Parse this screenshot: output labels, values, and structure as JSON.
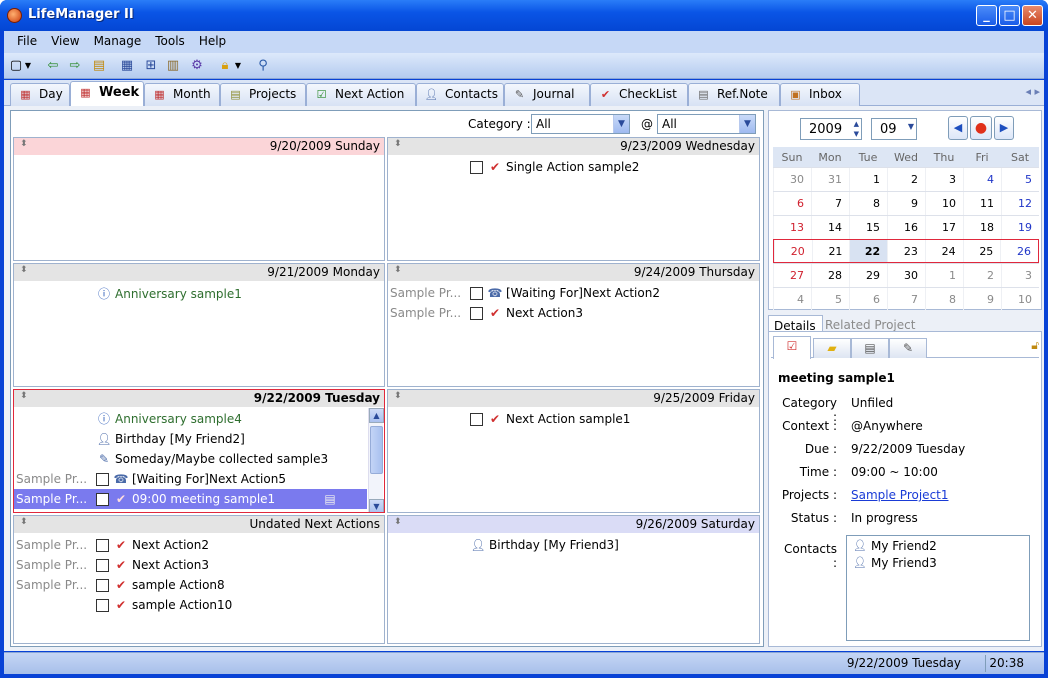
{
  "window": {
    "title": "LifeManager II"
  },
  "menu": [
    "File",
    "View",
    "Manage",
    "Tools",
    "Help"
  ],
  "tabs": [
    {
      "label": "Day",
      "icon": "calendar-day-icon"
    },
    {
      "label": "Week",
      "icon": "calendar-week-icon",
      "active": true
    },
    {
      "label": "Month",
      "icon": "calendar-month-icon"
    },
    {
      "label": "Projects",
      "icon": "projects-icon"
    },
    {
      "label": "Next Action",
      "icon": "next-action-icon"
    },
    {
      "label": "Contacts",
      "icon": "contacts-icon"
    },
    {
      "label": "Journal",
      "icon": "journal-icon"
    },
    {
      "label": "CheckList",
      "icon": "checklist-icon"
    },
    {
      "label": "Ref.Note",
      "icon": "refnote-icon"
    },
    {
      "label": "Inbox",
      "icon": "inbox-icon"
    }
  ],
  "filter": {
    "category_label": "Category :",
    "category_value": "All",
    "at_label": "@",
    "context_value": "All"
  },
  "days": {
    "sun": {
      "date": "9/20/2009 Sunday"
    },
    "mon": {
      "date": "9/21/2009 Monday",
      "items": [
        {
          "text": "Anniversary sample1"
        }
      ]
    },
    "tue": {
      "date": "9/22/2009 Tuesday",
      "items": [
        {
          "text": "Anniversary sample4"
        },
        {
          "text": "Birthday [My Friend2]"
        },
        {
          "text": "Someday/Maybe collected sample3"
        },
        {
          "project": "Sample Pr...",
          "text": "[Waiting For]Next Action5"
        },
        {
          "project": "Sample Pr...",
          "text": "09:00 meeting sample1"
        }
      ]
    },
    "undated": {
      "date": "Undated Next Actions",
      "items": [
        {
          "project": "Sample Pr...",
          "text": "Next Action2"
        },
        {
          "project": "Sample Pr...",
          "text": "Next Action3"
        },
        {
          "project": "Sample Pr...",
          "text": "sample Action8"
        },
        {
          "project": "",
          "text": "sample Action10"
        }
      ]
    },
    "wed": {
      "date": "9/23/2009 Wednesday",
      "items": [
        {
          "text": "Single Action sample2"
        }
      ]
    },
    "thu": {
      "date": "9/24/2009 Thursday",
      "items": [
        {
          "project": "Sample Pr...",
          "text": "[Waiting For]Next Action2"
        },
        {
          "project": "Sample Pr...",
          "text": "Next Action3"
        }
      ]
    },
    "fri": {
      "date": "9/25/2009 Friday",
      "items": [
        {
          "text": "Next Action sample1"
        }
      ]
    },
    "sat": {
      "date": "9/26/2009 Saturday",
      "items": [
        {
          "text": "Birthday [My Friend3]"
        }
      ]
    }
  },
  "calendar": {
    "year": "2009",
    "month": "09",
    "weekdays": [
      "Sun",
      "Mon",
      "Tue",
      "Wed",
      "Thu",
      "Fri",
      "Sat"
    ],
    "weeks": [
      [
        "30",
        "31",
        "1",
        "2",
        "3",
        "4",
        "5"
      ],
      [
        "6",
        "7",
        "8",
        "9",
        "10",
        "11",
        "12"
      ],
      [
        "13",
        "14",
        "15",
        "16",
        "17",
        "18",
        "19"
      ],
      [
        "20",
        "21",
        "22",
        "23",
        "24",
        "25",
        "26"
      ],
      [
        "27",
        "28",
        "29",
        "30",
        "1",
        "2",
        "3"
      ],
      [
        "4",
        "5",
        "6",
        "7",
        "8",
        "9",
        "10"
      ]
    ],
    "today": "22"
  },
  "details": {
    "tab_details": "Details",
    "tab_related": "Related Project",
    "title": "meeting sample1",
    "fields": [
      {
        "k": "Category :",
        "v": "Unfiled"
      },
      {
        "k": "Context :",
        "v": "@Anywhere"
      },
      {
        "k": "Due :",
        "v": "9/22/2009 Tuesday"
      },
      {
        "k": "Time :",
        "v": "09:00 ~ 10:00"
      },
      {
        "k": "Projects :",
        "v": "Sample Project1"
      },
      {
        "k": "Status :",
        "v": "In progress"
      }
    ],
    "contacts_label": "Contacts :",
    "contacts": [
      "My Friend2",
      "My Friend3"
    ]
  },
  "status": {
    "date": "9/22/2009 Tuesday",
    "time": "20:38"
  }
}
